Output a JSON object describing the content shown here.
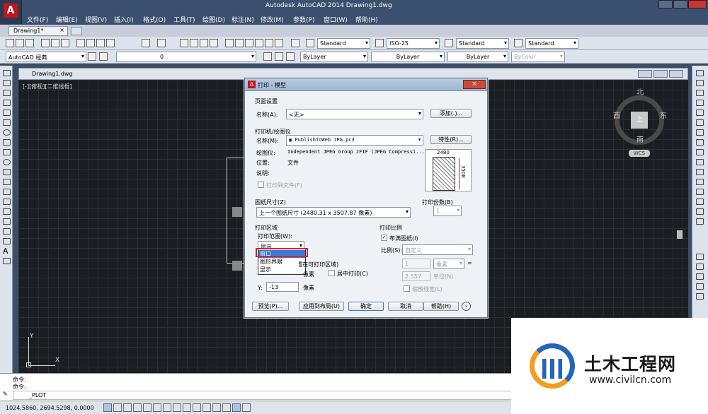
{
  "app": {
    "title": "Autodesk AutoCAD 2014    Drawing1.dwg"
  },
  "menu": [
    "文件(F)",
    "编辑(E)",
    "视图(V)",
    "插入(I)",
    "格式(O)",
    "工具(T)",
    "绘图(D)",
    "标注(N)",
    "修改(M)",
    "参数(P)",
    "窗口(W)",
    "帮助(H)"
  ],
  "file_tab": "Drawing1*",
  "toolbar1": {
    "text_style": "Standard",
    "dim_style": "ISO-25",
    "table_style": "Standard",
    "mleader_style": "Standard"
  },
  "toolbar2": {
    "workspace": "AutoCAD 经典",
    "layer": "0",
    "color": "ByLayer",
    "linetype": "ByLayer",
    "lineweight": "ByLayer",
    "plotstyle": "ByColor"
  },
  "doc": {
    "title": "Drawing1.dwg",
    "viewport_label": "[-][俯视][二维线框]"
  },
  "viewcube": {
    "north": "北",
    "south": "南",
    "east": "东",
    "west": "西",
    "top": "上",
    "wcs": "WCS"
  },
  "ucs": {
    "x": "X",
    "y": "Y"
  },
  "dialog": {
    "title": "打印 - 模型",
    "page_setup": {
      "group": "页面设置",
      "name_label": "名称(A):",
      "name_value": "<无>",
      "add_button": "添加(.)..."
    },
    "printer": {
      "group": "打印机/绘图仪",
      "name_label": "名称(M):",
      "name_value": "PublishToWeb JPG.pc3",
      "props_button": "特性(R)...",
      "plotter_label": "绘图仪:",
      "plotter_value": "Independent JPEG Group JFIF (JPEG Compressi...",
      "location_label": "位置:",
      "location_value": "文件",
      "desc_label": "说明:",
      "plot_to_file": "打印到文件(F)",
      "preview_w": "2480",
      "preview_h": "3508"
    },
    "paper": {
      "group": "图纸尺寸(Z)",
      "value": "上一个图纸尺寸   (2480.31 x 3507.87 像素)"
    },
    "copies": {
      "group": "打印份数(B)",
      "value": "1"
    },
    "area": {
      "group": "打印区域",
      "range_label": "打印范围(W):",
      "range_value": "显示",
      "options": [
        "窗口",
        "图形界限",
        "显示"
      ],
      "offset_group": "打印偏移(原点设置在可打印区域)",
      "x_unit": "像素",
      "center_label": "居中打印(C)",
      "y_label": "Y:",
      "y_value": "-13",
      "y_unit": "像素"
    },
    "scale": {
      "group": "打印比例",
      "fit_label": "布满图纸(I)",
      "scale_label": "比例(S):",
      "scale_value": "自定义",
      "v1": "1",
      "unit": "像素",
      "equals": "=",
      "v2": "2.557",
      "unit_label": "单位(N)",
      "lw_label": "缩放线宽(L)"
    },
    "buttons": {
      "preview": "预览(P)...",
      "apply": "应用到布局(U)",
      "ok": "确定",
      "cancel": "取消",
      "help": "帮助(H)"
    }
  },
  "command": {
    "line1": "命令:",
    "line2": "命令:",
    "prompt": "_PLOT"
  },
  "status": {
    "coords": "1024.5860, 2694.5298, 0.0000"
  },
  "watermark": {
    "cn": "土木工程网",
    "url": "www.civilcn.com"
  }
}
